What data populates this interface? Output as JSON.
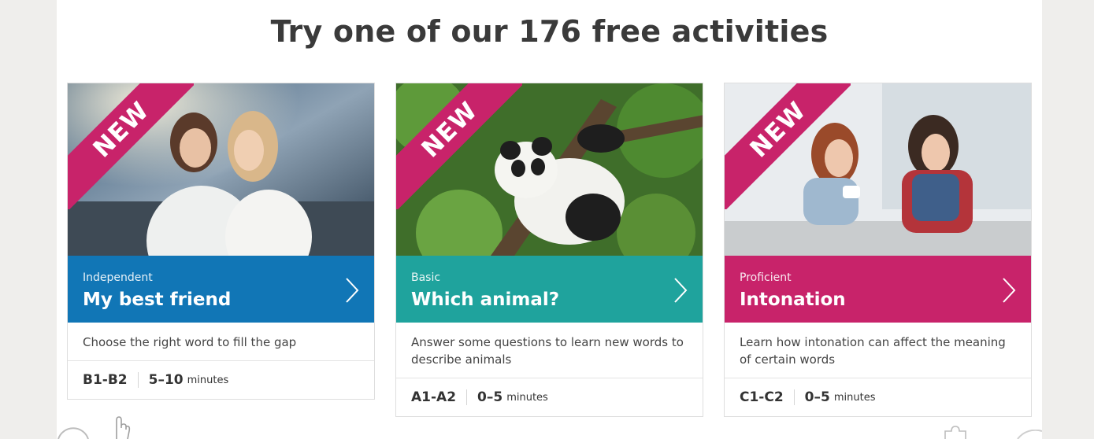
{
  "heading": "Try one of our 176 free activities",
  "badge": "NEW",
  "cards": [
    {
      "level": "Independent",
      "title": "My best friend",
      "description": "Choose the right word to fill the gap",
      "cefr": "B1-B2",
      "duration": "5–10",
      "unit": "minutes",
      "color": "#1176b6",
      "image": "two-friends-hugging-photo"
    },
    {
      "level": "Basic",
      "title": "Which animal?",
      "description": "Answer some questions to learn new words to describe animals",
      "cefr": "A1-A2",
      "duration": "0–5",
      "unit": "minutes",
      "color": "#1fa39d",
      "image": "panda-in-tree-photo"
    },
    {
      "level": "Proficient",
      "title": "Intonation",
      "description": "Learn how intonation can affect the meaning of certain words",
      "cefr": "C1-C2",
      "duration": "0–5",
      "unit": "minutes",
      "color": "#c8236a",
      "image": "women-chatting-at-cafe-photo"
    }
  ]
}
